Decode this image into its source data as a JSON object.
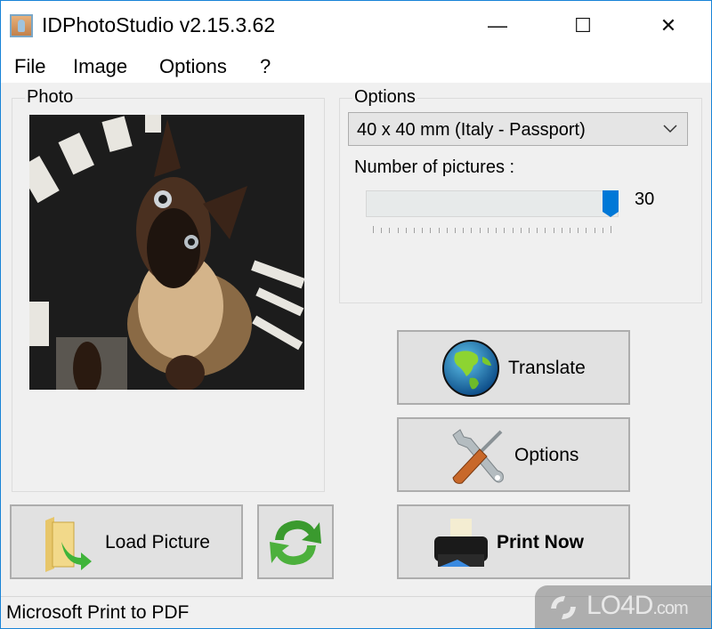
{
  "window": {
    "title": "IDPhotoStudio v2.15.3.62",
    "controls": {
      "minimize": "—",
      "maximize": "☐",
      "close": "✕"
    }
  },
  "menu": [
    "File",
    "Image",
    "Options",
    "?"
  ],
  "photo_group": {
    "label": "Photo",
    "image_description": "Siamese cat photo"
  },
  "options_group": {
    "label": "Options",
    "format_selected": "40 x 40 mm (Italy - Passport)",
    "number_label": "Number of pictures :",
    "number_value": "30",
    "slider_fraction": 1.0
  },
  "buttons": {
    "translate": "Translate",
    "options": "Options",
    "print_now": "Print Now",
    "load_picture": "Load Picture",
    "refresh_icon": "refresh-icon"
  },
  "status": {
    "printer": "Microsoft Print to PDF"
  },
  "watermark": {
    "brand": "LO4D",
    "suffix": ".com"
  },
  "colors": {
    "accent": "#1883d7",
    "slider_thumb": "#0078d7"
  }
}
